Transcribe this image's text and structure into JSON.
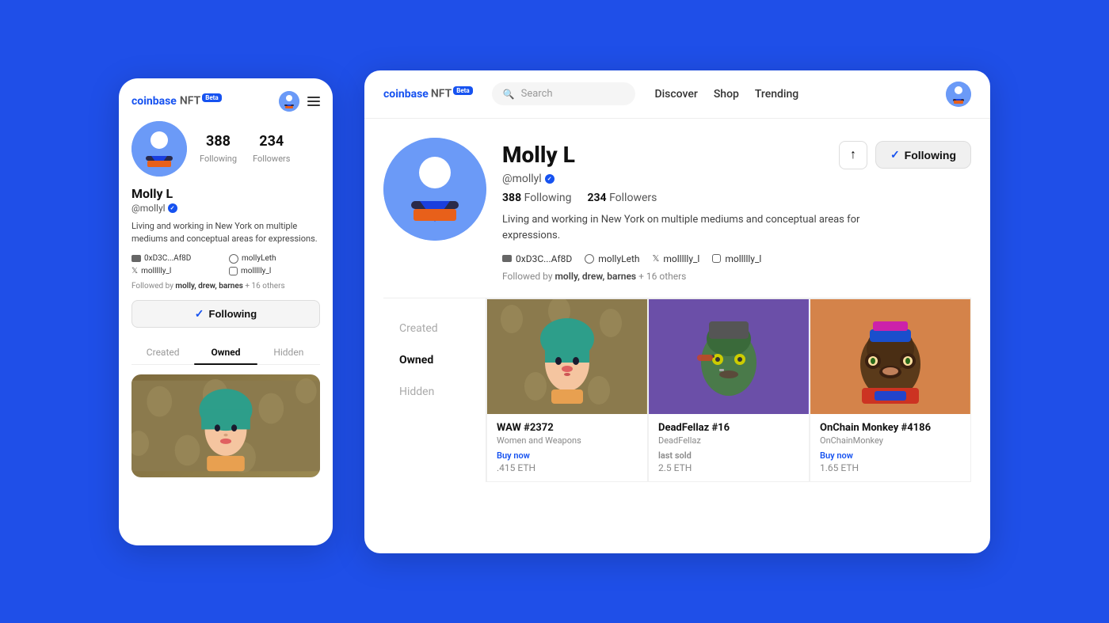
{
  "app": {
    "name": "coinbase",
    "nft": "NFT",
    "beta": "Beta"
  },
  "nav": {
    "search_placeholder": "Search",
    "discover": "Discover",
    "shop": "Shop",
    "trending": "Trending"
  },
  "profile": {
    "name": "Molly L",
    "handle": "@mollyl",
    "verified": true,
    "following_count": "388",
    "following_label": "Following",
    "followers_count": "234",
    "followers_label": "Followers",
    "bio": "Living and working in New York on multiple mediums and conceptual areas for expressions.",
    "wallet": "0xD3C...Af8D",
    "website": "mollyLeth",
    "twitter": "mollllly_l",
    "instagram": "mollllly_l",
    "followed_by": "Followed by",
    "followed_names": "molly, drew, barnes",
    "followed_others": "+ 16 others"
  },
  "buttons": {
    "following": "Following",
    "share": "↑"
  },
  "tabs": {
    "created": "Created",
    "owned": "Owned",
    "hidden": "Hidden"
  },
  "nfts": [
    {
      "id": "nft-1",
      "title": "WAW #2372",
      "collection": "Women and Weapons",
      "price_label": "Buy now",
      "price": ".415",
      "currency": "ETH",
      "bg": "waw"
    },
    {
      "id": "nft-2",
      "title": "DeadFellaz #16",
      "collection": "DeadFellaz",
      "price_label": "last sold",
      "price": "2.5",
      "currency": "ETH",
      "bg": "dead"
    },
    {
      "id": "nft-3",
      "title": "OnChain Monkey #4186",
      "collection": "OnChainMonkey",
      "price_label": "Buy now",
      "price": "1.65",
      "currency": "ETH",
      "bg": "monkey"
    }
  ]
}
